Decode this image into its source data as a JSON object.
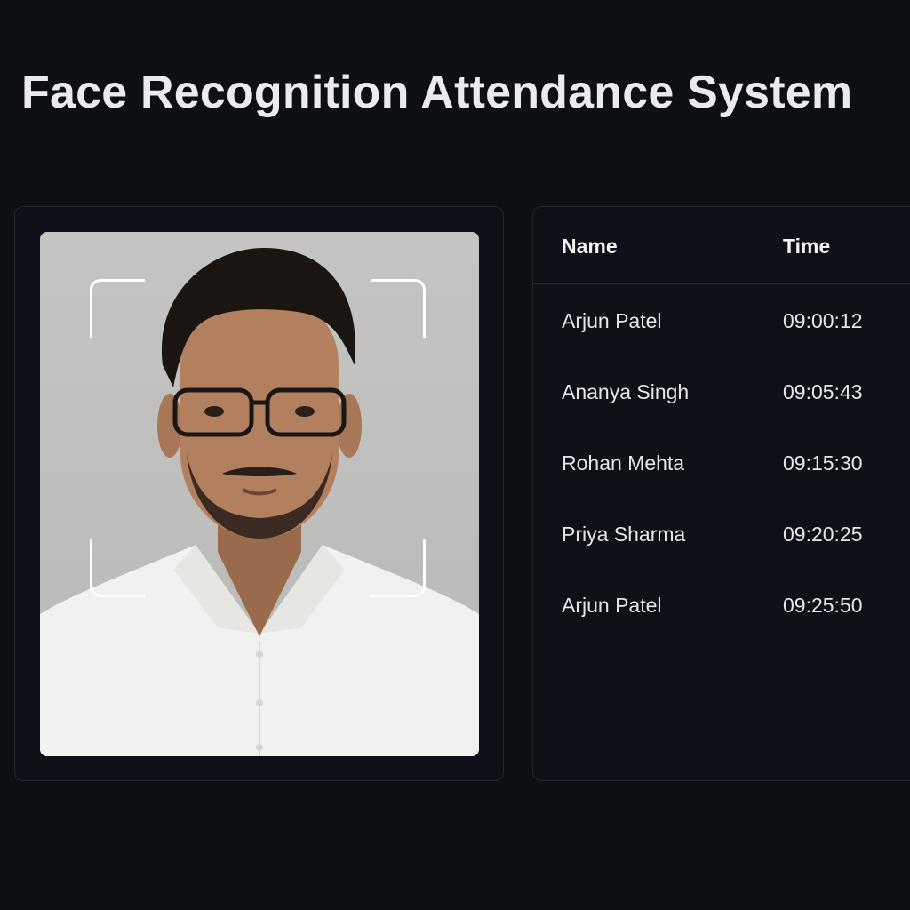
{
  "header": {
    "title": "Face Recognition Attendance System"
  },
  "camera": {
    "icon": "face-scan-frame"
  },
  "attendance": {
    "columns": {
      "name": "Name",
      "time": "Time"
    },
    "rows": [
      {
        "name": "Arjun Patel",
        "time": "09:00:12"
      },
      {
        "name": "Ananya Singh",
        "time": "09:05:43"
      },
      {
        "name": "Rohan Mehta",
        "time": "09:15:30"
      },
      {
        "name": "Priya Sharma",
        "time": "09:20:25"
      },
      {
        "name": "Arjun Patel",
        "time": "09:25:50"
      }
    ]
  },
  "colors": {
    "background": "#0c0f14",
    "panel_border": "#23272f",
    "text": "#e6e8ec",
    "scan_frame": "#ffffff"
  }
}
